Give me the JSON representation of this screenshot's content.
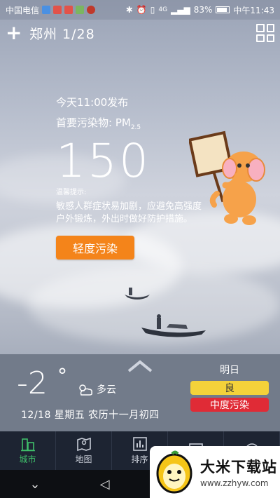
{
  "status_bar": {
    "carrier": "中国电信",
    "signal": "4G",
    "battery": "83%",
    "time": "中午11:43"
  },
  "header": {
    "add_icon": "plus-icon",
    "city_title": "郑州 1/28",
    "grid_icon": "grid-icon"
  },
  "aqi": {
    "publish_time": "今天11:00发布",
    "primary_pollutant_label": "首要污染物: PM",
    "primary_pollutant_sub": "2.5",
    "value": "150",
    "tip_label": "温馨提示:",
    "tip_text": "敏感人群症状易加剧，应避免高强度户外锻炼，外出时做好防护措施。",
    "level": "轻度污染",
    "level_color": "#f4841a"
  },
  "weather": {
    "temperature": "-2",
    "degree_symbol": "°",
    "condition": "多云",
    "condition_icon": "partly-cloudy-icon",
    "date_line": "12/18  星期五  农历十一月初四"
  },
  "tomorrow": {
    "label": "明日",
    "quality_1": "良",
    "quality_1_color": "#f4d23a",
    "quality_2": "中度污染",
    "quality_2_color": "#e02b36"
  },
  "tabs": [
    {
      "label": "城市",
      "icon": "city-icon",
      "active": true
    },
    {
      "label": "地图",
      "icon": "map-icon",
      "active": false
    },
    {
      "label": "排序",
      "icon": "ranking-icon",
      "active": false
    },
    {
      "label": "",
      "icon": "trend-icon",
      "active": false
    },
    {
      "label": "",
      "icon": "aqi-icon",
      "active": false
    }
  ],
  "tab_active_color": "#3fbf6a",
  "watermark": {
    "title": "大米下载站",
    "url": "www.zzhyw.com"
  }
}
